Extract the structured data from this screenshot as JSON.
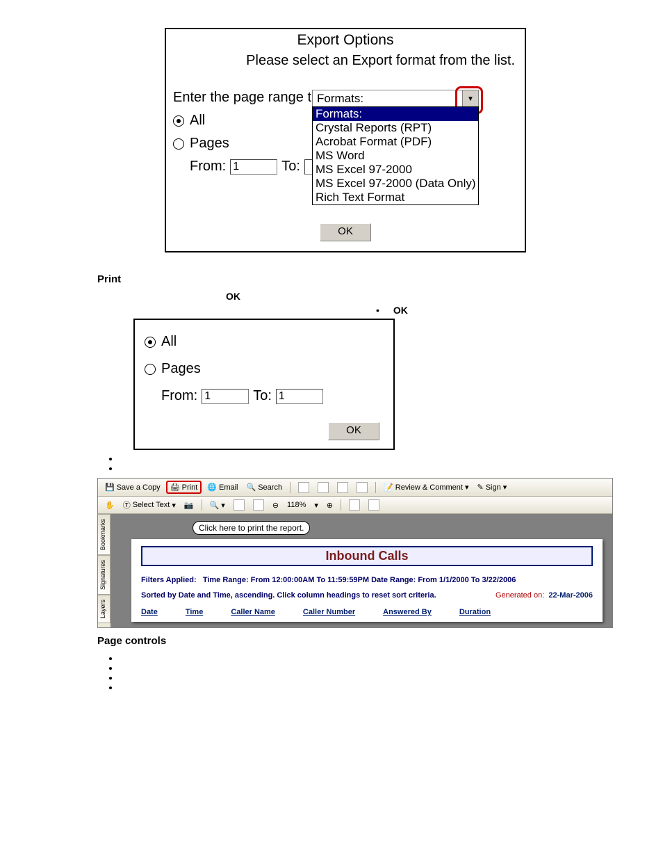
{
  "export_dialog": {
    "title": "Export Options",
    "subtitle": "Please select an Export format from the list.",
    "combo_label": "Formats:",
    "options": {
      "header": "Formats:",
      "items": [
        "Crystal Reports (RPT)",
        "Acrobat Format (PDF)",
        "MS Word",
        "MS Excel 97-2000",
        "MS Excel 97-2000 (Data Only)",
        "Rich Text Format"
      ]
    },
    "range_prompt": "Enter the page range tha",
    "radio_all": "All",
    "radio_pages": "Pages",
    "from_label": "From:",
    "from_value": "1",
    "to_label": "To:",
    "to_value": "",
    "ok": "OK"
  },
  "section_print": "Print",
  "ok_text1": "OK",
  "ok_text2": "OK",
  "print_dialog": {
    "radio_all": "All",
    "radio_pages": "Pages",
    "from_label": "From:",
    "from_value": "1",
    "to_label": "To:",
    "to_value": "1",
    "ok": "OK"
  },
  "acrobat": {
    "buttons": {
      "save": "Save a Copy",
      "print": "Print",
      "email": "Email",
      "search": "Search",
      "review": "Review & Comment",
      "sign": "Sign",
      "select_text": "Select Text",
      "zoom": "118%"
    },
    "tooltip": "Click here to print the report.",
    "side_tabs": [
      "Bookmarks",
      "Signatures",
      "Layers"
    ],
    "report": {
      "title": "Inbound Calls",
      "filters_label": "Filters Applied:",
      "filters_value": "Time Range: From 12:00:00AM To 11:59:59PM Date Range: From 1/1/2000 To 3/22/2006",
      "sort_info": "Sorted by Date and Time, ascending. Click column headings to reset sort criteria.",
      "generated_label": "Generated on:",
      "generated_date": "22-Mar-2006",
      "columns": [
        "Date",
        "Time",
        "Caller Name",
        "Caller Number",
        "Answered By",
        "Duration"
      ]
    }
  },
  "section_page_controls": "Page controls"
}
